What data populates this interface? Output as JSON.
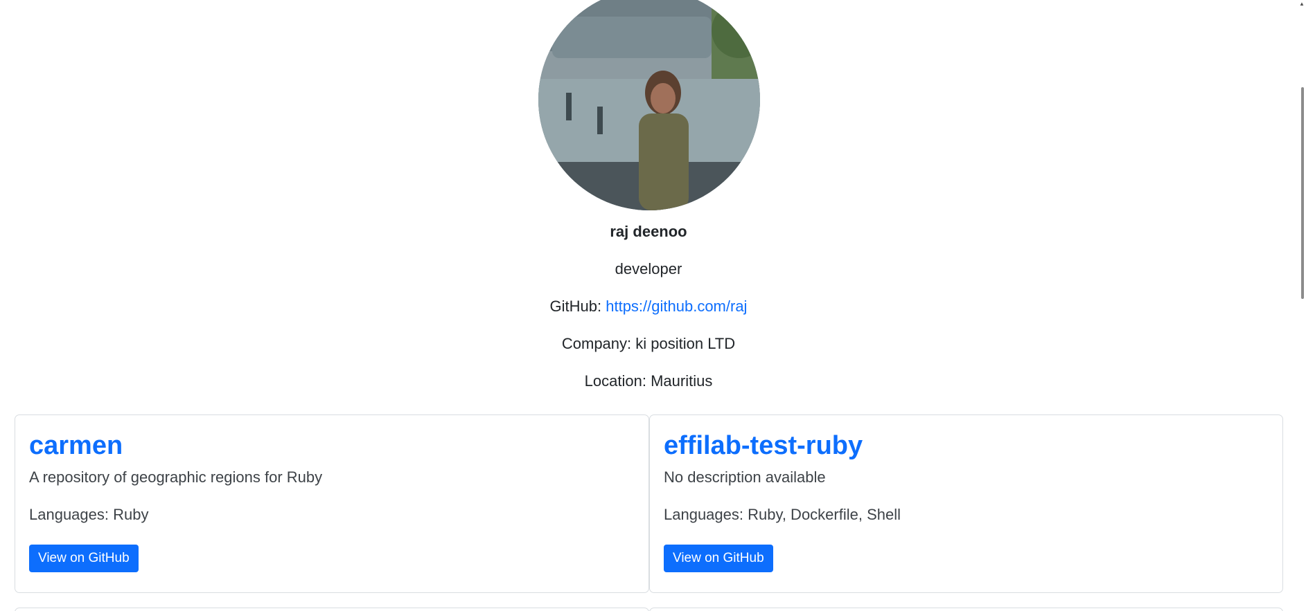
{
  "profile": {
    "name": "raj deenoo",
    "bio": "developer",
    "github_label": "GitHub: ",
    "github_url": "https://github.com/raj",
    "company": "Company: ki position LTD",
    "location": "Location: Mauritius",
    "avatar_icon": "profile-photo"
  },
  "repos": [
    {
      "name": "carmen",
      "description": "A repository of geographic regions for Ruby",
      "languages": "Languages: Ruby",
      "button_label": "View on GitHub"
    },
    {
      "name": "effilab-test-ruby",
      "description": "No description available",
      "languages": "Languages: Ruby, Dockerfile, Shell",
      "button_label": "View on GitHub"
    }
  ],
  "colors": {
    "link": "#0d6efd",
    "button_bg": "#0d6efd",
    "card_border": "#d9dde1"
  }
}
